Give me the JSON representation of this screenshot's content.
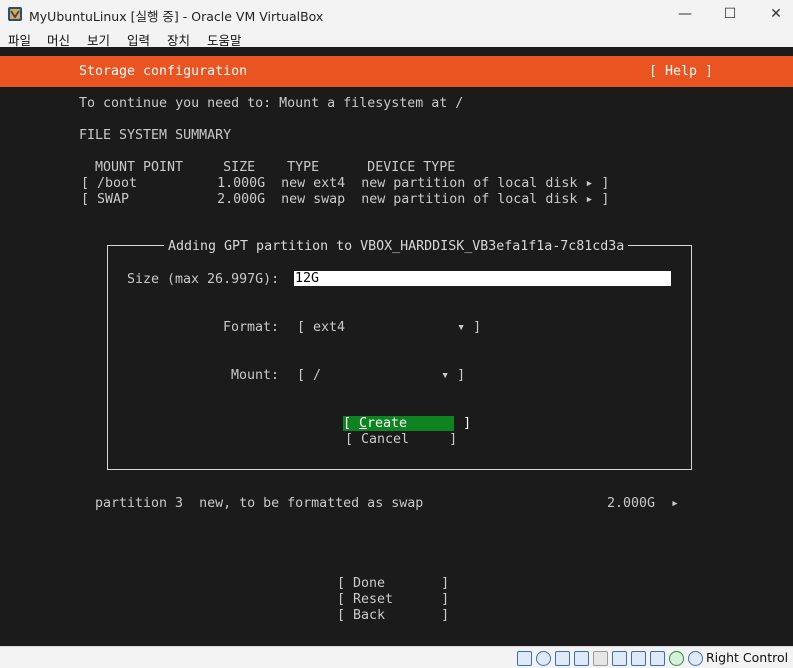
{
  "window": {
    "title": "MyUbuntuLinux [실행 중] - Oracle VM VirtualBox",
    "minimize": "—",
    "maximize": "☐",
    "close": "✕"
  },
  "menu": [
    "파일",
    "머신",
    "보기",
    "입력",
    "장치",
    "도움말"
  ],
  "header": {
    "title": "Storage configuration",
    "help": "[ Help ]",
    "accent_color": "#e95420"
  },
  "notice": "To continue you need to: Mount a filesystem at /",
  "summary": {
    "heading": "FILE SYSTEM SUMMARY",
    "columns_line": "MOUNT POINT     SIZE    TYPE      DEVICE TYPE",
    "rows": [
      "[ /boot          1.000G  new ext4  new partition of local disk ▸ ]",
      "[ SWAP           2.000G  new swap  new partition of local disk ▸ ]"
    ]
  },
  "dialog": {
    "title": "Adding GPT partition to VBOX_HARDDISK_VB3efa1f1a-7c81cd3a",
    "size_label": "Size (max 26.997G):",
    "size_value": "12G",
    "format_label": "Format:",
    "format_value": "[ ext4              ▾ ]",
    "mount_label": "Mount:",
    "mount_value": "[ /               ▾ ]",
    "create_open": "[ ",
    "create_hotkey": "C",
    "create_rest": "reate       ]",
    "cancel": "[ Cancel     ]",
    "button_color": "#0e8420"
  },
  "partition_line": {
    "text": "partition 3  new, to be formatted as swap",
    "size": "2.000G",
    "arrow": "▸"
  },
  "actions": {
    "done": "[ Done       ]",
    "reset": "[ Reset      ]",
    "back": "[ Back       ]"
  },
  "statusbar": {
    "host_key": "Right Control",
    "icons": [
      "hdd-icon",
      "optical-icon",
      "audio-icon",
      "usb-icon",
      "shared-folder-icon",
      "display-icon",
      "recording-icon",
      "network-icon",
      "capture-icon",
      "mouse-integration-icon",
      "download-icon"
    ]
  }
}
